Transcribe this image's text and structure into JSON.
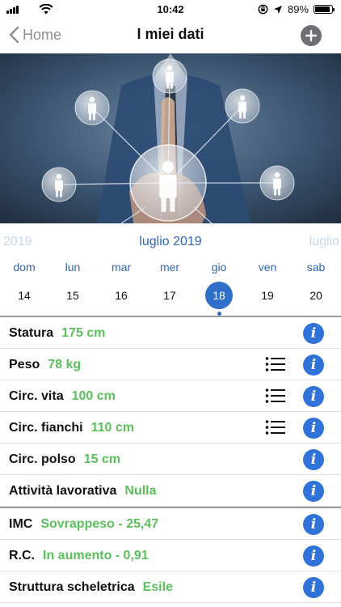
{
  "status": {
    "time": "10:42",
    "battery": "89%",
    "battery_level": 0.89
  },
  "nav": {
    "back_label": "Home",
    "title": "I miei dati"
  },
  "hero": {
    "icons": [
      "person-icon"
    ]
  },
  "calendar": {
    "prev_month": "2019",
    "current_month": "luglio 2019",
    "next_month": "luglio",
    "days": [
      "dom",
      "lun",
      "mar",
      "mer",
      "gio",
      "ven",
      "sab"
    ],
    "dates": [
      "14",
      "15",
      "16",
      "17",
      "18",
      "19",
      "20"
    ],
    "selected_date": "18"
  },
  "measures": [
    {
      "label": "Statura",
      "value": "175 cm",
      "has_list": false
    },
    {
      "label": "Peso",
      "value": "78 kg",
      "has_list": true
    },
    {
      "label": "Circ. vita",
      "value": "100 cm",
      "has_list": true
    },
    {
      "label": "Circ. fianchi",
      "value": "110 cm",
      "has_list": true
    },
    {
      "label": "Circ. polso",
      "value": "15 cm",
      "has_list": false
    },
    {
      "label": "Attività lavorativa",
      "value": "Nulla",
      "has_list": false
    }
  ],
  "results": [
    {
      "label": "IMC",
      "value": "Sovrappeso - 25,47"
    },
    {
      "label": "R.C.",
      "value": "In aumento - 0,91"
    },
    {
      "label": "Struttura scheletrica",
      "value": "Esile"
    }
  ],
  "colors": {
    "accent_blue": "#2f73d8",
    "value_green": "#5ac05a",
    "month_blue": "#2f66b2"
  }
}
